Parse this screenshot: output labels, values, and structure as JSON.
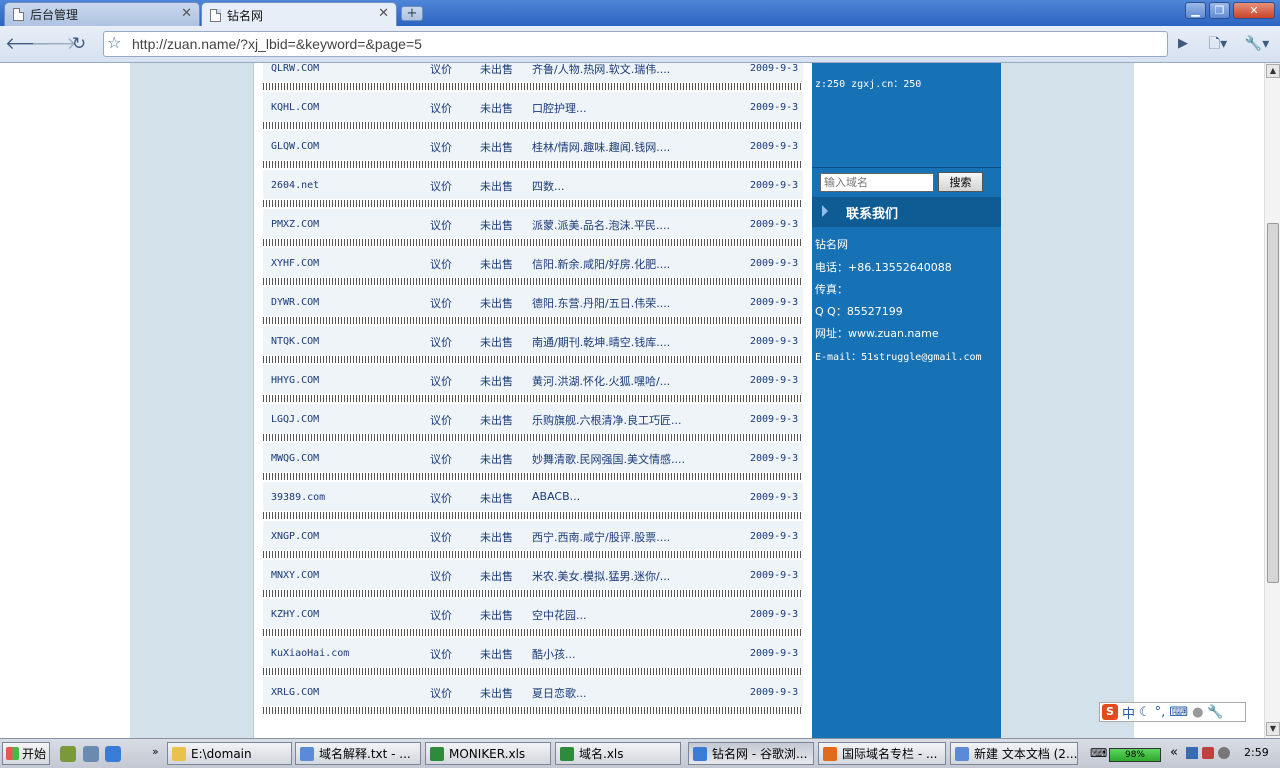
{
  "browser": {
    "tabs": [
      {
        "label": "后台管理",
        "active": false
      },
      {
        "label": "钻名网",
        "active": true
      }
    ],
    "url": "http://zuan.name/?xj_lbid=&keyword=&page=5"
  },
  "domains": [
    {
      "name": "QLRW.COM",
      "price": "议价",
      "status": "未出售",
      "desc": "齐鲁/人物.热网.软文.瑞伟....",
      "date": "2009-9-3"
    },
    {
      "name": "KQHL.COM",
      "price": "议价",
      "status": "未出售",
      "desc": "口腔护理...",
      "date": "2009-9-3"
    },
    {
      "name": "GLQW.COM",
      "price": "议价",
      "status": "未出售",
      "desc": "桂林/情网.趣味.趣闻.钱网....",
      "date": "2009-9-3"
    },
    {
      "name": "2604.net",
      "price": "议价",
      "status": "未出售",
      "desc": "四数...",
      "date": "2009-9-3"
    },
    {
      "name": "PMXZ.COM",
      "price": "议价",
      "status": "未出售",
      "desc": "派蒙.派美.品名.泡沫.平民....",
      "date": "2009-9-3"
    },
    {
      "name": "XYHF.COM",
      "price": "议价",
      "status": "未出售",
      "desc": "信阳.新余.咸阳/好房.化肥....",
      "date": "2009-9-3"
    },
    {
      "name": "DYWR.COM",
      "price": "议价",
      "status": "未出售",
      "desc": "德阳.东营.丹阳/五日.伟荣....",
      "date": "2009-9-3"
    },
    {
      "name": "NTQK.COM",
      "price": "议价",
      "status": "未出售",
      "desc": "南通/期刊.乾坤.晴空.钱库....",
      "date": "2009-9-3"
    },
    {
      "name": "HHYG.COM",
      "price": "议价",
      "status": "未出售",
      "desc": "黄河.洪湖.怀化.火狐.嘿哈/...",
      "date": "2009-9-3"
    },
    {
      "name": "LGQJ.COM",
      "price": "议价",
      "status": "未出售",
      "desc": "乐购旗舰.六根清净.良工巧匠...",
      "date": "2009-9-3"
    },
    {
      "name": "MWQG.COM",
      "price": "议价",
      "status": "未出售",
      "desc": "妙舞清歌.民网强国.美文情感....",
      "date": "2009-9-3"
    },
    {
      "name": "39389.com",
      "price": "议价",
      "status": "未出售",
      "desc": "ABACB...",
      "date": "2009-9-3"
    },
    {
      "name": "XNGP.COM",
      "price": "议价",
      "status": "未出售",
      "desc": "西宁.西南.咸宁/股评.股票....",
      "date": "2009-9-3"
    },
    {
      "name": "MNXY.COM",
      "price": "议价",
      "status": "未出售",
      "desc": "米农.美女.模拟.猛男.迷你/...",
      "date": "2009-9-3"
    },
    {
      "name": "KZHY.COM",
      "price": "议价",
      "status": "未出售",
      "desc": "空中花园...",
      "date": "2009-9-3"
    },
    {
      "name": "KuXiaoHai.com",
      "price": "议价",
      "status": "未出售",
      "desc": "酷小孩...",
      "date": "2009-9-3"
    },
    {
      "name": "XRLG.COM",
      "price": "议价",
      "status": "未出售",
      "desc": "夏日恋歌...",
      "date": "2009-9-3"
    }
  ],
  "sidebar": {
    "top_lines": [
      "z:250 zgxj.cn：250"
    ],
    "search_placeholder": "输入域名",
    "search_button": "搜索",
    "contact_title": "联系我们",
    "contact": {
      "company": "钻名网",
      "phone": "电话：+86.13552640088",
      "fax": "传真：",
      "qq": "Q  Q：85527199",
      "site": "网址：www.zuan.name",
      "email": "E-mail：51struggle@gmail.com"
    }
  },
  "taskbar": {
    "start": "开始",
    "tasks": [
      {
        "label": "E:\\domain",
        "color": "#e8c24a"
      },
      {
        "label": "域名解释.txt - ...",
        "color": "#5b8bd8"
      },
      {
        "label": "MONIKER.xls",
        "color": "#2e8b3e"
      },
      {
        "label": "域名.xls",
        "color": "#2e8b3e"
      },
      {
        "label": "钻名网 - 谷歌浏...",
        "color": "#3a7bd5",
        "active": true
      },
      {
        "label": "国际域名专栏 - ...",
        "color": "#e06a1b"
      },
      {
        "label": "新建 文本文档 (2...",
        "color": "#5b8bd8"
      }
    ],
    "battery": "98%",
    "clock": "2:59"
  },
  "colors": {
    "sidebar": "#1672b5",
    "page_bg": "#d2e1ea",
    "link": "#1a3a7a"
  }
}
